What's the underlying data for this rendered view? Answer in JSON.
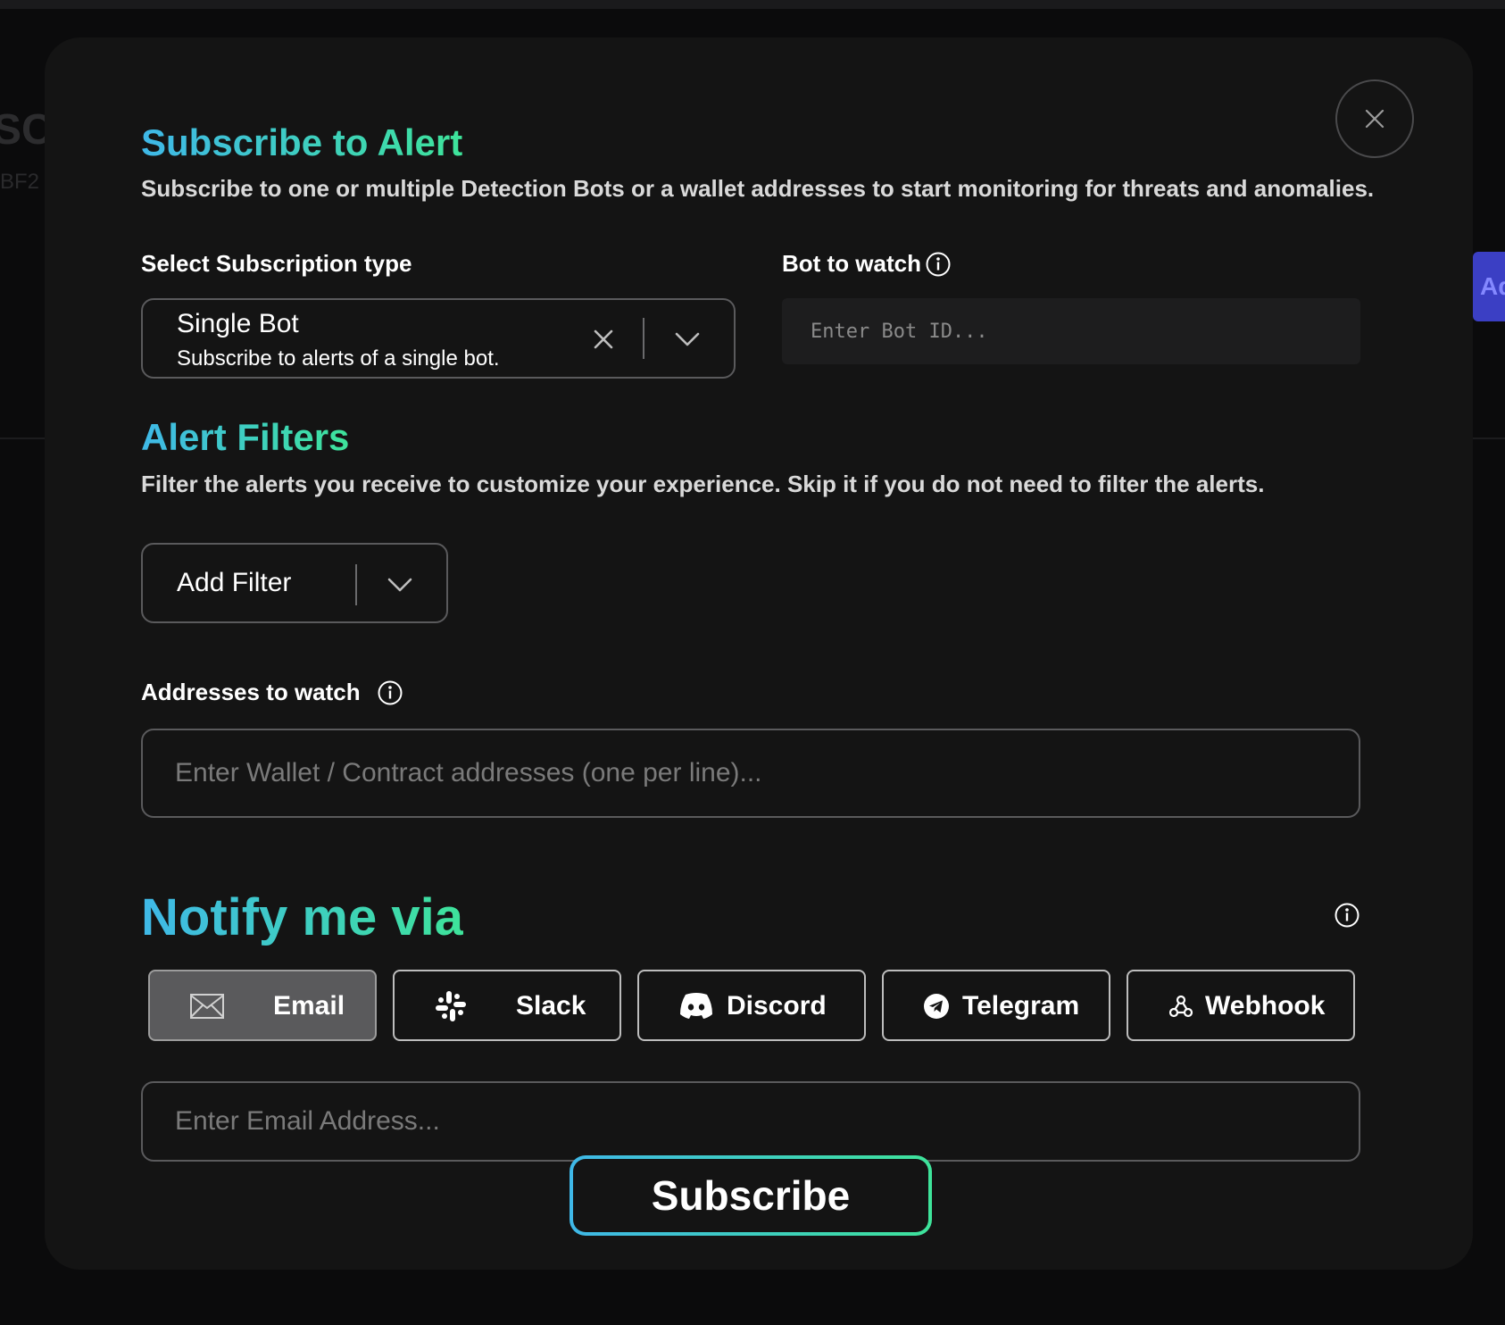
{
  "background": {
    "partial_title": "SC",
    "partial_sub": "BF2",
    "partial_button": "Ad"
  },
  "modal": {
    "title": "Subscribe to Alert",
    "description": "Subscribe to one or multiple Detection Bots or a wallet addresses to start monitoring for threats and anomalies.",
    "close_icon": "close-icon"
  },
  "subscription": {
    "label": "Select Subscription type",
    "selected_title": "Single Bot",
    "selected_desc": "Subscribe to alerts of a single bot."
  },
  "bot": {
    "label": "Bot to watch",
    "placeholder": "Enter Bot ID..."
  },
  "filters": {
    "title": "Alert Filters",
    "description": "Filter the alerts you receive to customize your experience. Skip it if you do not need to filter the alerts.",
    "add_filter_label": "Add Filter",
    "addresses_label": "Addresses to watch",
    "addresses_placeholder": "Enter Wallet / Contract addresses (one per line)..."
  },
  "notify": {
    "title": "Notify me via",
    "selected": "Email",
    "channels": [
      {
        "label": "Email",
        "icon": "mail-icon"
      },
      {
        "label": "Slack",
        "icon": "slack-icon"
      },
      {
        "label": "Discord",
        "icon": "discord-icon"
      },
      {
        "label": "Telegram",
        "icon": "telegram-icon"
      },
      {
        "label": "Webhook",
        "icon": "webhook-icon"
      }
    ],
    "email_placeholder": "Enter Email Address..."
  },
  "subscribe_label": "Subscribe",
  "colors": {
    "accent_start": "#3fb8e8",
    "accent_end": "#3ee39a",
    "modal_bg": "#141414"
  }
}
